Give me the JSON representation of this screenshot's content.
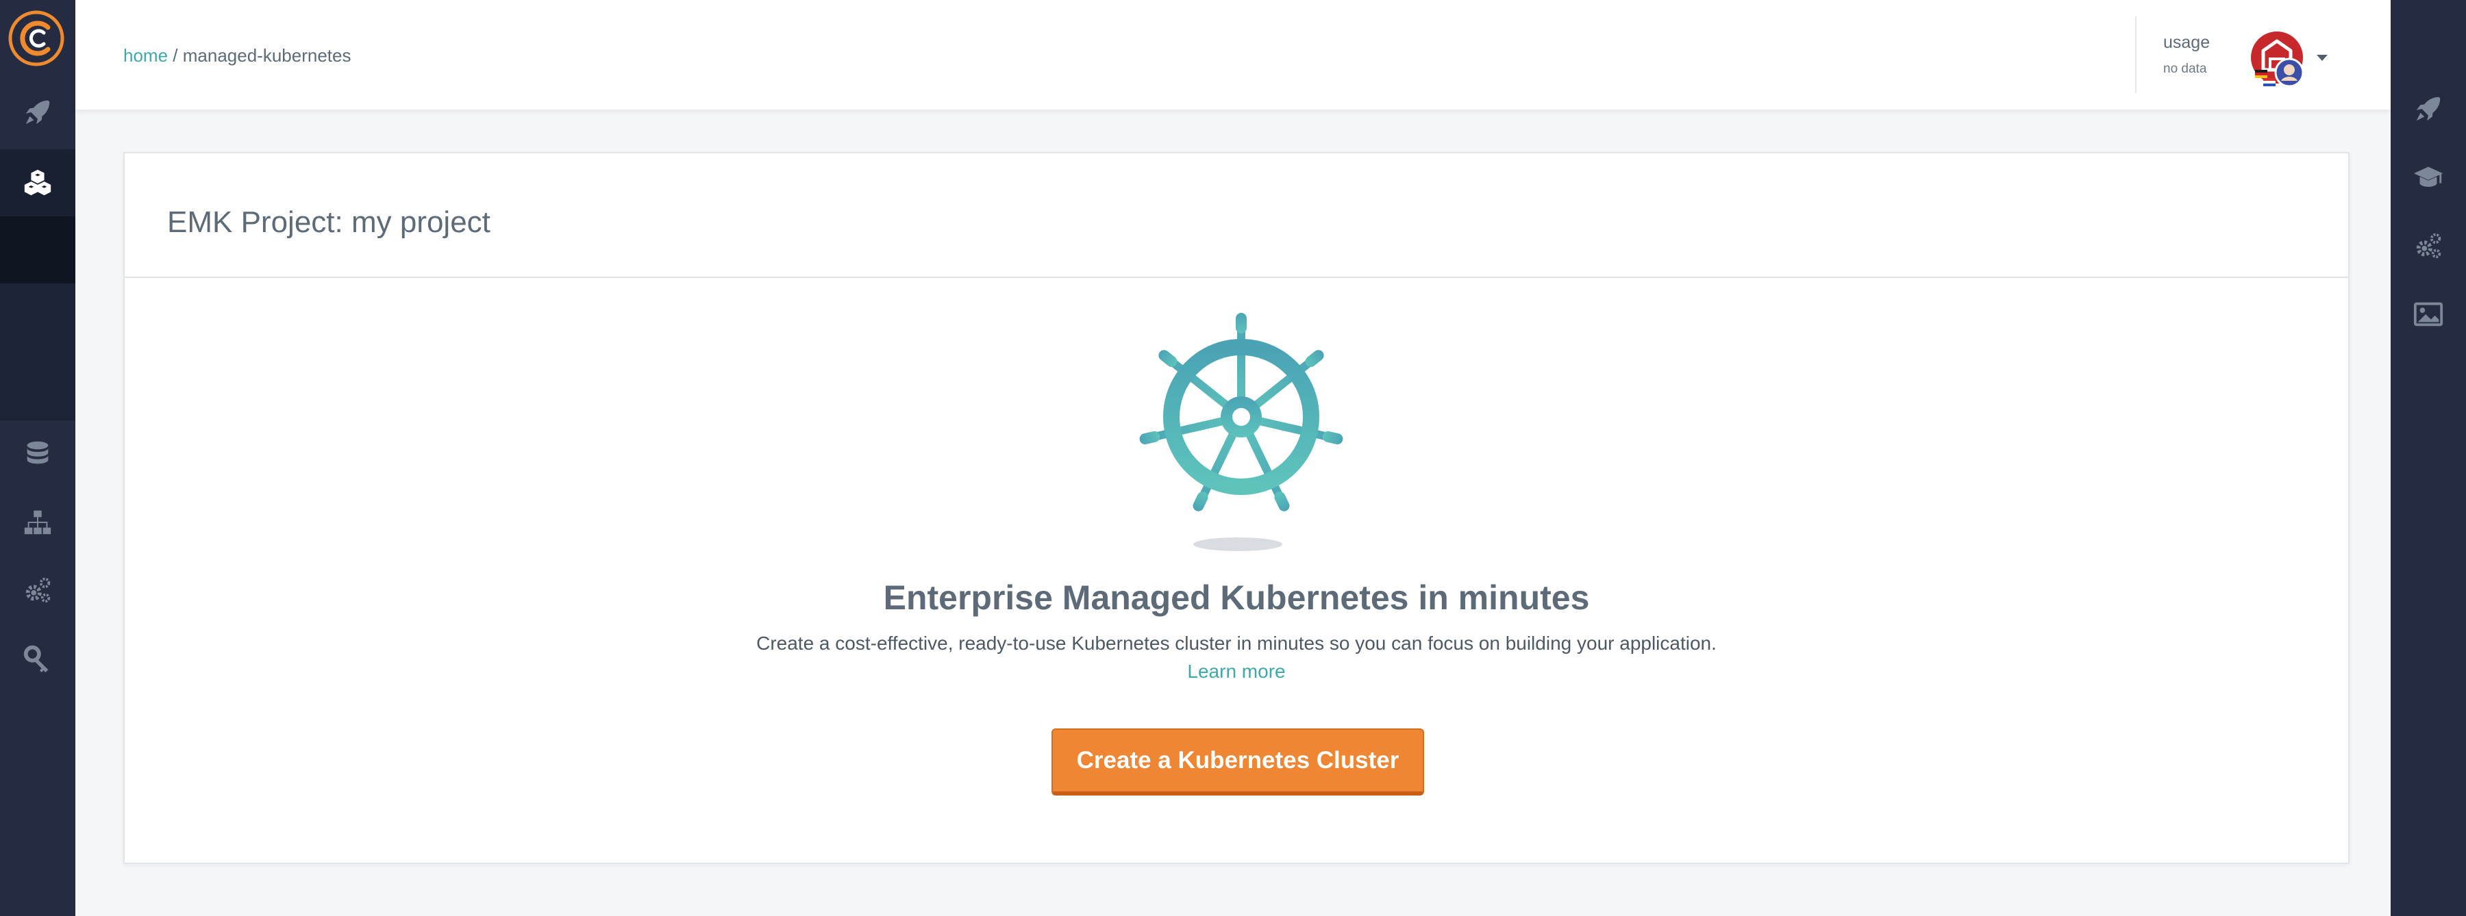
{
  "header": {
    "breadcrumb": {
      "home": "home",
      "separator": "/",
      "current": "managed-kubernetes"
    },
    "usage": {
      "label": "usage",
      "value": "no data"
    }
  },
  "left_sidebar": {
    "items": [
      {
        "icon": "rocket-icon"
      },
      {
        "icon": "cubes-icon",
        "active": true
      },
      {
        "icon": "database-icon"
      },
      {
        "icon": "sitemap-icon"
      },
      {
        "icon": "gears-icon"
      },
      {
        "icon": "key-icon"
      }
    ]
  },
  "right_sidebar": {
    "items": [
      {
        "icon": "rocket-icon"
      },
      {
        "icon": "graduation-cap-icon"
      },
      {
        "icon": "gears-icon"
      },
      {
        "icon": "image-icon"
      }
    ]
  },
  "main": {
    "card_title": "EMK Project: my project",
    "hero_title": "Enterprise Managed Kubernetes in minutes",
    "hero_description": "Create a cost-effective, ready-to-use Kubernetes cluster in minutes so you can focus on building your application.",
    "learn_more": "Learn more",
    "cta_label": "Create a Kubernetes Cluster"
  },
  "colors": {
    "sidebar_bg": "#252c41",
    "accent_teal": "#3fa9a8",
    "cta_orange": "#ef8634",
    "text": "#5c6b77"
  }
}
